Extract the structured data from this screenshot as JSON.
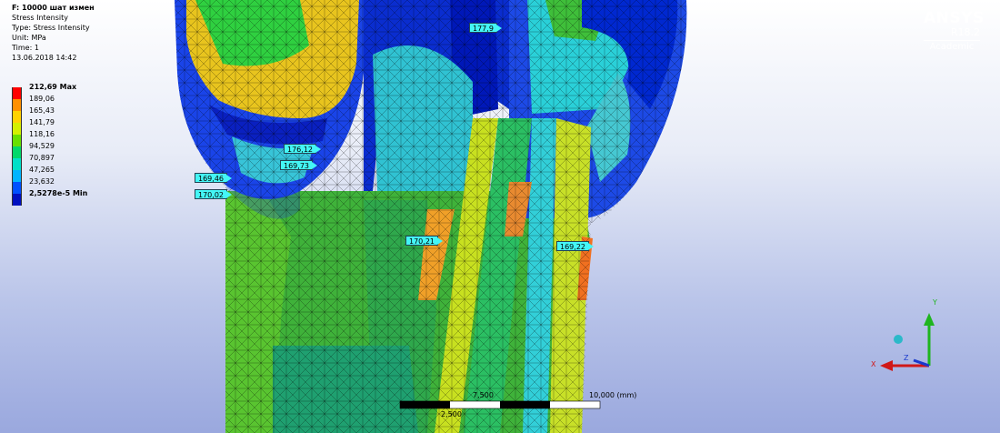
{
  "result_info": {
    "title": "F: 10000 шат измен",
    "lines": [
      "Stress Intensity",
      "Type: Stress Intensity",
      "Unit: MPa",
      "Time: 1",
      "13.06.2018 14:42"
    ]
  },
  "legend": [
    {
      "label": "212,69 Max",
      "color": "#ff0000",
      "bold": true
    },
    {
      "label": "189,06",
      "color": "#ff9000"
    },
    {
      "label": "165,43",
      "color": "#ffd200"
    },
    {
      "label": "141,79",
      "color": "#d4f000"
    },
    {
      "label": "118,16",
      "color": "#68e000"
    },
    {
      "label": "94,529",
      "color": "#00d86a"
    },
    {
      "label": "70,897",
      "color": "#00e0c8"
    },
    {
      "label": "47,265",
      "color": "#00b4ff"
    },
    {
      "label": "23,632",
      "color": "#0050ff"
    },
    {
      "label": "2,5278e-5 Min",
      "color": "#0010c0",
      "bold": true
    }
  ],
  "logo": {
    "brand": "ANSYS",
    "version": "R18.2",
    "edition": "Academic"
  },
  "probes": [
    "177,9",
    "176,12",
    "169,73",
    "169,46",
    "170,02",
    "170,21",
    "169,22"
  ],
  "scale_bar": {
    "total_label": "10,000 (mm)",
    "mid_label_left": "2,500",
    "mid_label_right": "7,500"
  },
  "triad": {
    "x": "X",
    "y": "Y",
    "z": "Z"
  }
}
